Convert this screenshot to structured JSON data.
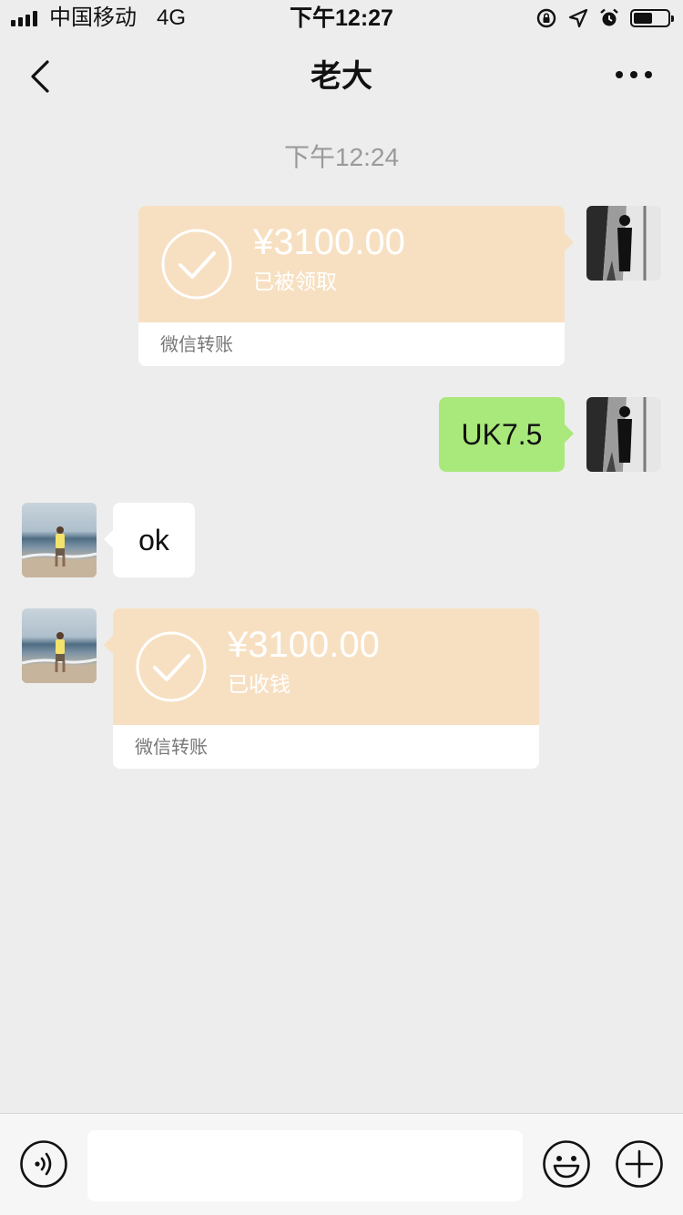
{
  "status_bar": {
    "carrier": "中国移动",
    "network": "4G",
    "time": "下午12:27",
    "battery_level_percent": 55
  },
  "nav": {
    "title": "老大",
    "back_icon": "chevron-left-icon",
    "more_icon": "more-dots-icon"
  },
  "chat": {
    "timestamp": "下午12:24",
    "messages": [
      {
        "sender": "me",
        "kind": "transfer",
        "amount": "¥3100.00",
        "status": "已被领取",
        "footer": "微信转账"
      },
      {
        "sender": "me",
        "kind": "text",
        "text": "UK7.5"
      },
      {
        "sender": "friend",
        "kind": "text",
        "text": "ok"
      },
      {
        "sender": "friend",
        "kind": "transfer",
        "amount": "¥3100.00",
        "status": "已收钱",
        "footer": "微信转账"
      }
    ]
  },
  "input_bar": {
    "voice_icon": "voice-icon",
    "text_value": "",
    "emoji_icon": "emoji-icon",
    "add_icon": "plus-circle-icon"
  },
  "colors": {
    "background": "#ededed",
    "transfer_card": "#f7e0c2",
    "my_bubble": "#a9e87a",
    "friend_bubble": "#ffffff",
    "timestamp_text": "#9a9a9a"
  }
}
